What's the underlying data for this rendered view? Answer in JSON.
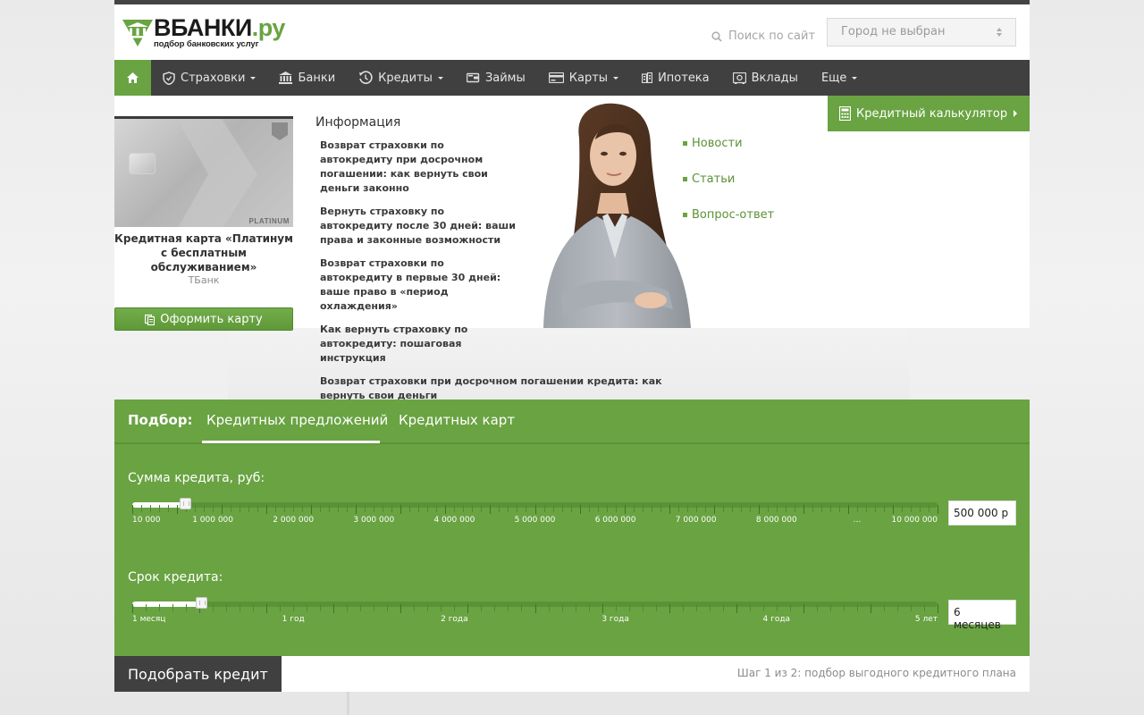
{
  "header": {
    "logo_name": "ВБАНКИ",
    "logo_tld": ".ру",
    "logo_sub": "подбор банковских услуг",
    "search_label": "Поиск по сайт",
    "city_select": "Город не выбран"
  },
  "nav": {
    "items": [
      {
        "label": "Страховки",
        "icon": "shield-icon",
        "dropdown": true
      },
      {
        "label": "Банки",
        "icon": "bank-icon",
        "dropdown": false
      },
      {
        "label": "Кредиты",
        "icon": "clock-arrow-icon",
        "dropdown": true
      },
      {
        "label": "Займы",
        "icon": "wallet-icon",
        "dropdown": false
      },
      {
        "label": "Карты",
        "icon": "card-icon",
        "dropdown": true
      },
      {
        "label": "Ипотека",
        "icon": "building-icon",
        "dropdown": false
      },
      {
        "label": "Вклады",
        "icon": "safe-icon",
        "dropdown": false
      },
      {
        "label": "Еще",
        "icon": "",
        "dropdown": true
      }
    ]
  },
  "promo_card": {
    "image_text": "PLATINUM",
    "title": "Кредитная карта «Платинум с бесплатным обслуживанием»",
    "bank": "ТБанк",
    "button": "Оформить карту"
  },
  "info": {
    "heading": "Информация",
    "items": [
      "Возврат страховки по автокредиту при досрочном погашении: как вернуть свои деньги законно",
      "Вернуть страховку по автокредиту после 30 дней: ваши права и законные возможности",
      "Возврат страховки по автокредиту в первые 30 дней: ваше право в «период охлаждения»",
      "Как вернуть страховку по автокредиту: пошаговая инструкция",
      "Возврат страховки при досрочном погашении кредита: как вернуть свои деньги"
    ]
  },
  "side_links": [
    "Новости",
    "Статьи",
    "Вопрос-ответ"
  ],
  "calculator_button": "Кредитный калькулятор",
  "form": {
    "label": "Подбор:",
    "tabs": [
      {
        "label": "Кредитных предложений",
        "active": true
      },
      {
        "label": "Кредитных карт",
        "active": false
      }
    ],
    "amount": {
      "label": "Сумма кредита, руб:",
      "scale": [
        "10 000",
        "1 000 000",
        "2 000 000",
        "3 000 000",
        "4 000 000",
        "5 000 000",
        "6 000 000",
        "7 000 000",
        "8 000 000",
        "...",
        "10 000 000"
      ],
      "value": "500 000 р",
      "position": 0.065
    },
    "term": {
      "label": "Срок кредита:",
      "scale": [
        "1 месяц",
        "1 год",
        "2 года",
        "3 года",
        "4 года",
        "5 лет"
      ],
      "value": "6 месяцев",
      "position": 0.085
    },
    "submit": "Подобрать кредит",
    "step": "Шаг 1 из 2: подбор выгодного кредитного плана"
  }
}
